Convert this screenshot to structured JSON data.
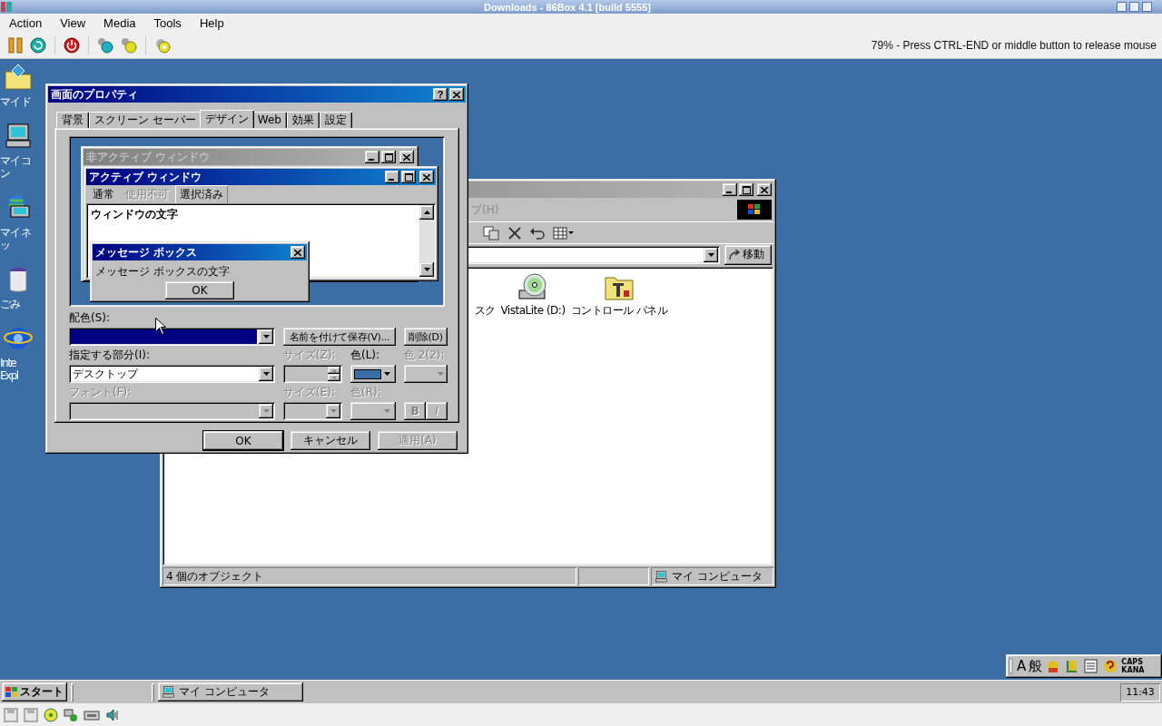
{
  "host": {
    "title": "Downloads - 86Box 4.1 [build 5555]",
    "menu": [
      "Action",
      "View",
      "Media",
      "Tools",
      "Help"
    ],
    "status": "79% - Press CTRL-END or middle button to release mouse"
  },
  "desktop_icons": [
    {
      "kind": "documents",
      "label": "マイ ド"
    },
    {
      "kind": "computer",
      "label": "マイ コン"
    },
    {
      "kind": "network",
      "label": "マイ ネッ"
    },
    {
      "kind": "trash",
      "label": "ごみ"
    },
    {
      "kind": "browser",
      "label": "Inte Expl"
    }
  ],
  "explorer": {
    "menu_tail": "プ(H)",
    "go_button": "移動",
    "items": [
      {
        "kind": "label_only",
        "label": "スク"
      },
      {
        "kind": "cdrom",
        "label": "VistaLite (D:)"
      },
      {
        "kind": "control_panel",
        "label": "コントロール パネル"
      }
    ],
    "status": {
      "count": "4 個のオブジェクト",
      "location": "マイ コンピュータ"
    }
  },
  "dialog": {
    "title": "画面のプロパティ",
    "help": "?",
    "tabs": [
      {
        "label": "背景",
        "selected": false
      },
      {
        "label": "スクリーン セーバー",
        "selected": false
      },
      {
        "label": "デザイン",
        "selected": true
      },
      {
        "label": "Web",
        "selected": false
      },
      {
        "label": "効果",
        "selected": false
      },
      {
        "label": "設定",
        "selected": false
      }
    ],
    "preview": {
      "inactive_title": "非アクティブ ウィンドウ",
      "active_title": "アクティブ ウィンドウ",
      "menu": [
        {
          "label": "通常",
          "kind": "normal"
        },
        {
          "label": "使用不可",
          "kind": "disabled"
        },
        {
          "label": "選択済み",
          "kind": "selected"
        }
      ],
      "window_text": "ウィンドウの文字",
      "message_title": "メッセージ ボックス",
      "message_text": "メッセージ ボックスの文字",
      "message_button": "OK"
    },
    "scheme": {
      "label": "配色(S):",
      "buttons": [
        {
          "label": "名前を付けて保存(V)...",
          "disabled": false
        },
        {
          "label": "削除(D)",
          "disabled": false
        }
      ]
    },
    "item": {
      "label": "指定する部分(I):",
      "value": "デスクトップ",
      "disabled": false
    },
    "size": {
      "label": "サイズ(Z):",
      "disabled": true
    },
    "color": {
      "label": "色(L):",
      "color": "#3a6ea5",
      "disabled": false
    },
    "color2": {
      "label": "色 2(2):",
      "disabled": true
    },
    "font": {
      "label": "フォント(F):",
      "disabled": true
    },
    "font_size": {
      "label": "サイズ(E):",
      "disabled": true
    },
    "font_color": {
      "label": "色(R):",
      "disabled": true
    },
    "style_buttons": [
      {
        "label": "B",
        "kind": "bold",
        "disabled": true
      },
      {
        "label": "I",
        "kind": "italic",
        "disabled": true
      }
    ],
    "buttons": [
      {
        "label": "OK",
        "disabled": false
      },
      {
        "label": "キャンセル",
        "disabled": false
      },
      {
        "label": "適用(A)",
        "disabled": true
      }
    ]
  },
  "tray": {
    "ime_mode": "A",
    "ime_kanji": "般",
    "caps": "CAPS",
    "kana": "KANA"
  },
  "taskbar": {
    "start": "スタート",
    "tasks": [
      {
        "label": "マイ コンピュータ",
        "selected": false
      }
    ],
    "clock": "11:43"
  }
}
